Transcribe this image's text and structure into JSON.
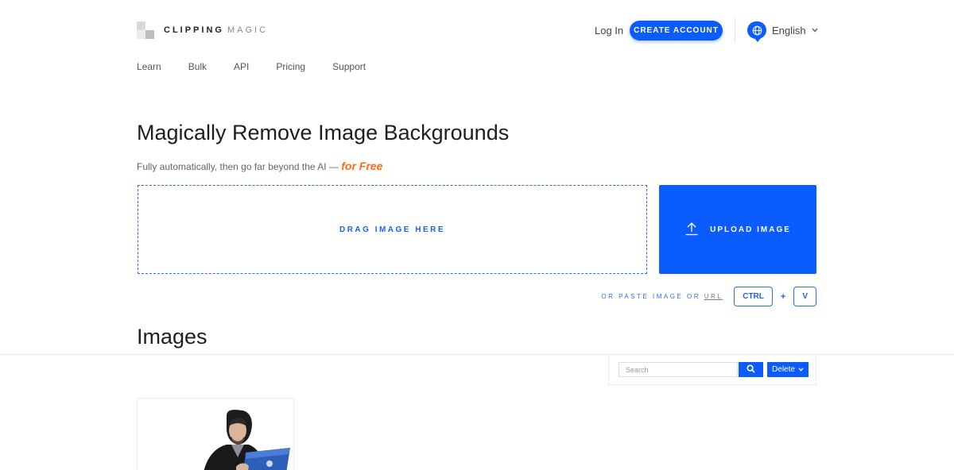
{
  "header": {
    "logo_primary": "CLIPPING",
    "logo_secondary": "MAGIC",
    "login_label": "Log In",
    "create_account_label": "CREATE ACCOUNT",
    "language_label": "English"
  },
  "nav": {
    "items": [
      {
        "label": "Learn"
      },
      {
        "label": "Bulk"
      },
      {
        "label": "API"
      },
      {
        "label": "Pricing"
      },
      {
        "label": "Support"
      }
    ]
  },
  "hero": {
    "title": "Magically Remove Image Backgrounds",
    "subtitle": "Fully automatically, then go far beyond the AI — ",
    "subtitle_emphasis": "for Free",
    "drop_label": "DRAG IMAGE HERE",
    "upload_label": "UPLOAD IMAGE",
    "paste_text": "OR PASTE IMAGE OR ",
    "paste_url": "URL",
    "key_ctrl": "CTRL",
    "key_plus": "+",
    "key_v": "V"
  },
  "images_section": {
    "heading": "Images",
    "search_placeholder": "Search",
    "delete_label": "Delete"
  },
  "colors": {
    "accent": "#0b5cff",
    "emphasis": "#ff6a13"
  },
  "icons": {
    "language": "globe-icon",
    "upload": "upload-arrow-icon",
    "search": "magnifier-icon",
    "dropdown": "chevron-down-icon"
  }
}
